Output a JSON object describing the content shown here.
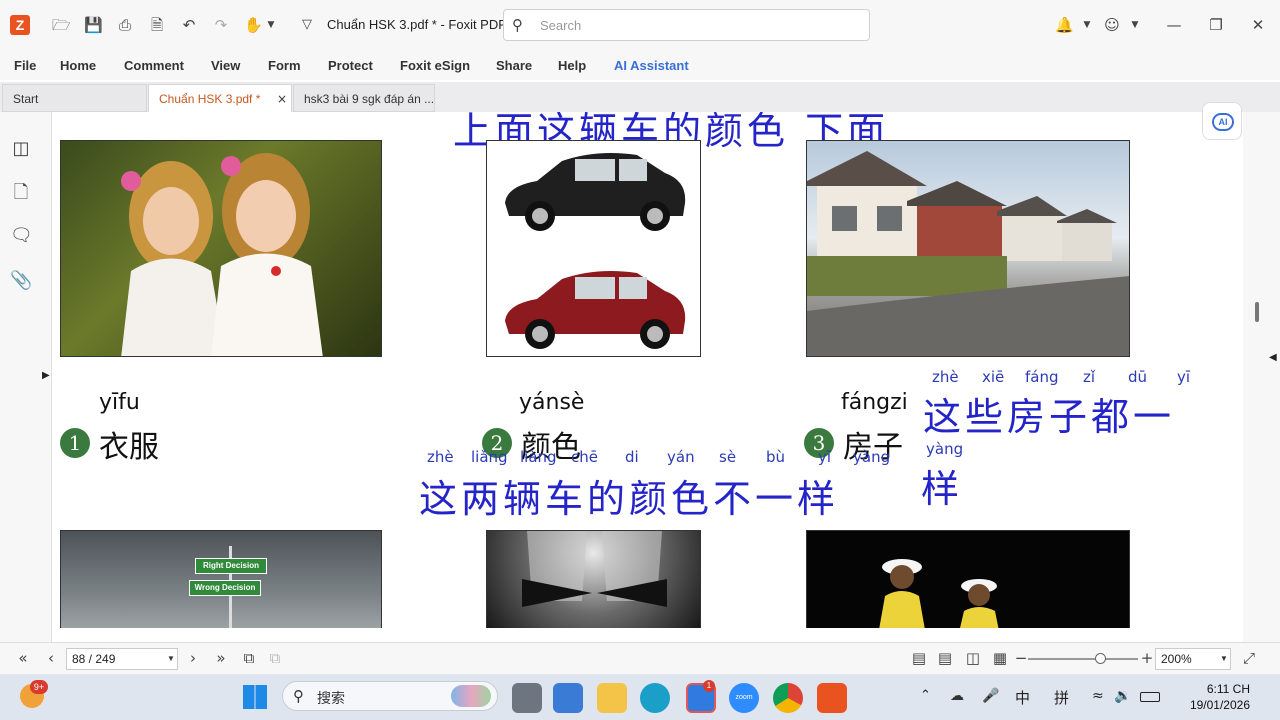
{
  "titlebar": {
    "title": "Chuẩn HSK 3.pdf * - Foxit PDF...",
    "search_placeholder": "Search"
  },
  "menu": {
    "items": [
      "File",
      "Home",
      "Comment",
      "View",
      "Form",
      "Protect",
      "Foxit eSign",
      "Share",
      "Help",
      "AI Assistant"
    ]
  },
  "tabs": [
    {
      "label": "Start"
    },
    {
      "label": "Chuẩn HSK 3.pdf *"
    },
    {
      "label": "hsk3 bài 9 sgk  đáp án ..."
    }
  ],
  "ai_badge": "AI",
  "document": {
    "top_line": "上面这辆车的颜色 下面",
    "items": [
      {
        "number": "1",
        "pinyin": "yīfu",
        "hanzi": "衣服"
      },
      {
        "number": "2",
        "pinyin": "yánsè",
        "hanzi": "颜色"
      },
      {
        "number": "3",
        "pinyin": "fángzi",
        "hanzi": "房子"
      }
    ],
    "sentence1_pinyin": [
      "zhè",
      "xiē",
      "fáng",
      "zǐ",
      "dū",
      "yī"
    ],
    "sentence1_hanzi": "这些房子都一",
    "sentence1_tail_pinyin": "yàng",
    "sentence1_tail_hanzi": "样",
    "sentence2_pinyin": [
      "zhè",
      "liǎng",
      "liàng",
      "chē",
      "di",
      "yán",
      "sè",
      "bù",
      "yī",
      "yàng"
    ],
    "sentence2_hanzi": "这两辆车的颜色不一样",
    "sign_right": "Right Decision",
    "sign_wrong": "Wrong Decision"
  },
  "status": {
    "page": "88 / 249",
    "zoom": "200%"
  },
  "taskbar": {
    "search_label": "搜索",
    "notify_badge": "9+",
    "zalo_badge": "1",
    "zoom_label": "zoom",
    "ime_1": "中",
    "ime_2": "拼",
    "time": "6:11 CH",
    "date": "19/01/2026"
  },
  "colors": {
    "accent_orange": "#e8531f",
    "handwriting_blue": "#2424c8",
    "ai_blue": "#3a6fd8",
    "number_green": "#3b7a3f"
  }
}
